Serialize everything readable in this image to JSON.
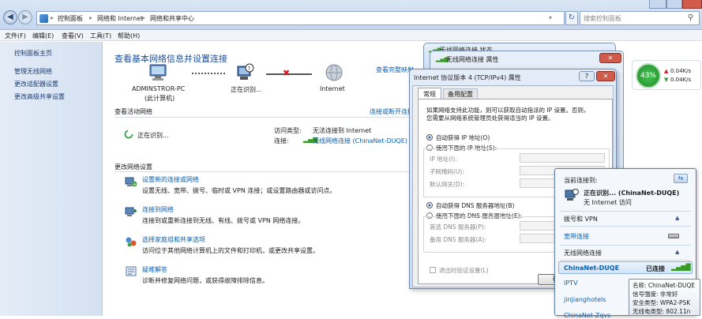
{
  "colors": {
    "link": "#0b5fb0",
    "heading": "#1e4e9c",
    "sidebar_bg": "#dfe8f4",
    "gauge": "#2fa83a",
    "signal": "#3a9a2a"
  },
  "explorer": {
    "breadcrumb": [
      "控制面板",
      "网络和 Internet",
      "网络和共享中心"
    ],
    "search_placeholder": "搜索控制面板",
    "menu": [
      "文件(F)",
      "编辑(E)",
      "查看(V)",
      "工具(T)",
      "帮助(H)"
    ],
    "sidebar": {
      "home": "控制面板主页",
      "links": [
        "管理无线网络",
        "更改适配器设置",
        "更改高级共享设置"
      ]
    },
    "main": {
      "title": "查看基本网络信息并设置连接",
      "full_map_link": "查看完整映射",
      "nodes": [
        {
          "name": "ADMINSTROR-PC",
          "sub": "(此计算机)"
        },
        {
          "name": "正在识别...",
          "sub": ""
        },
        {
          "name": "Internet",
          "sub": ""
        }
      ],
      "active_label": "查看活动网络",
      "connect_link": "连接或断开连接",
      "status": "正在识别...",
      "access_label": "访问类型:",
      "access_value": "无法连接到 Internet",
      "conn_label": "连接:",
      "conn_value": "无线网络连接 (ChinaNet-DUQE)",
      "change_label": "更改网络设置",
      "tasks": [
        {
          "title": "设置新的连接或网络",
          "desc": "设置无线、宽带、拨号、临时或 VPN 连接；或设置路由器或访问点。",
          "icon": "network-setup-icon"
        },
        {
          "title": "连接到网络",
          "desc": "连接到或重新连接到无线、有线、拨号或 VPN 网络连接。",
          "icon": "connect-network-icon"
        },
        {
          "title": "选择家庭组和共享选项",
          "desc": "访问位于其他网络计算机上的文件和打印机，或更改共享设置。",
          "icon": "homegroup-icon"
        },
        {
          "title": "疑难解答",
          "desc": "诊断并修复网络问题，或获得故障排除信息。",
          "icon": "troubleshoot-icon"
        }
      ]
    }
  },
  "gauge": {
    "percent": "43%",
    "up": "0.04K/s",
    "down": "0.04K/s"
  },
  "status_win": {
    "title": "无线网络连接 状态"
  },
  "props_win": {
    "title": "无线网络连接 属性"
  },
  "ipv4": {
    "title": "Internet 协议版本 4 (TCP/IPv4) 属性",
    "tabs": [
      "常规",
      "备用配置"
    ],
    "desc1": "如果网络支持此功能，则可以获取自动指派的 IP 设置。否则，",
    "desc2": "您需要从网络系统管理员处获得适当的 IP 设置。",
    "auto_ip": "自动获得 IP 地址(O)",
    "manual_ip": "使用下面的 IP 地址(S):",
    "ip_fields": [
      "IP 地址(I):",
      "子网掩码(U):",
      "默认网关(D):"
    ],
    "auto_dns": "自动获得 DNS 服务器地址(B)",
    "manual_dns": "使用下面的 DNS 服务器地址(E):",
    "dns_fields": [
      "首选 DNS 服务器(P):",
      "备用 DNS 服务器(A):"
    ],
    "validate": "退出时验证设置(L)",
    "ok_partial": "确"
  },
  "wifi": {
    "current": "当前连接到:",
    "network": "正在识别... (ChinaNet-DUQE)",
    "no_internet": "无 Internet 访问",
    "dialup": "拨号和 VPN",
    "broadband": "宽带连接",
    "wireless": "无线网络连接",
    "networks": [
      {
        "name": "ChinaNet-DUQE",
        "status": "已连接"
      },
      {
        "name": "IPTV",
        "status": ""
      },
      {
        "name": "jinjianghotels",
        "status": ""
      },
      {
        "name": "ChinaNet-Zqvs",
        "status": ""
      }
    ]
  },
  "tooltip": [
    "名称: ChinaNet-DUQE",
    "信号强度: 非常好",
    "安全类型: WPA2-PSK",
    "无线电类型: 802.11n"
  ]
}
